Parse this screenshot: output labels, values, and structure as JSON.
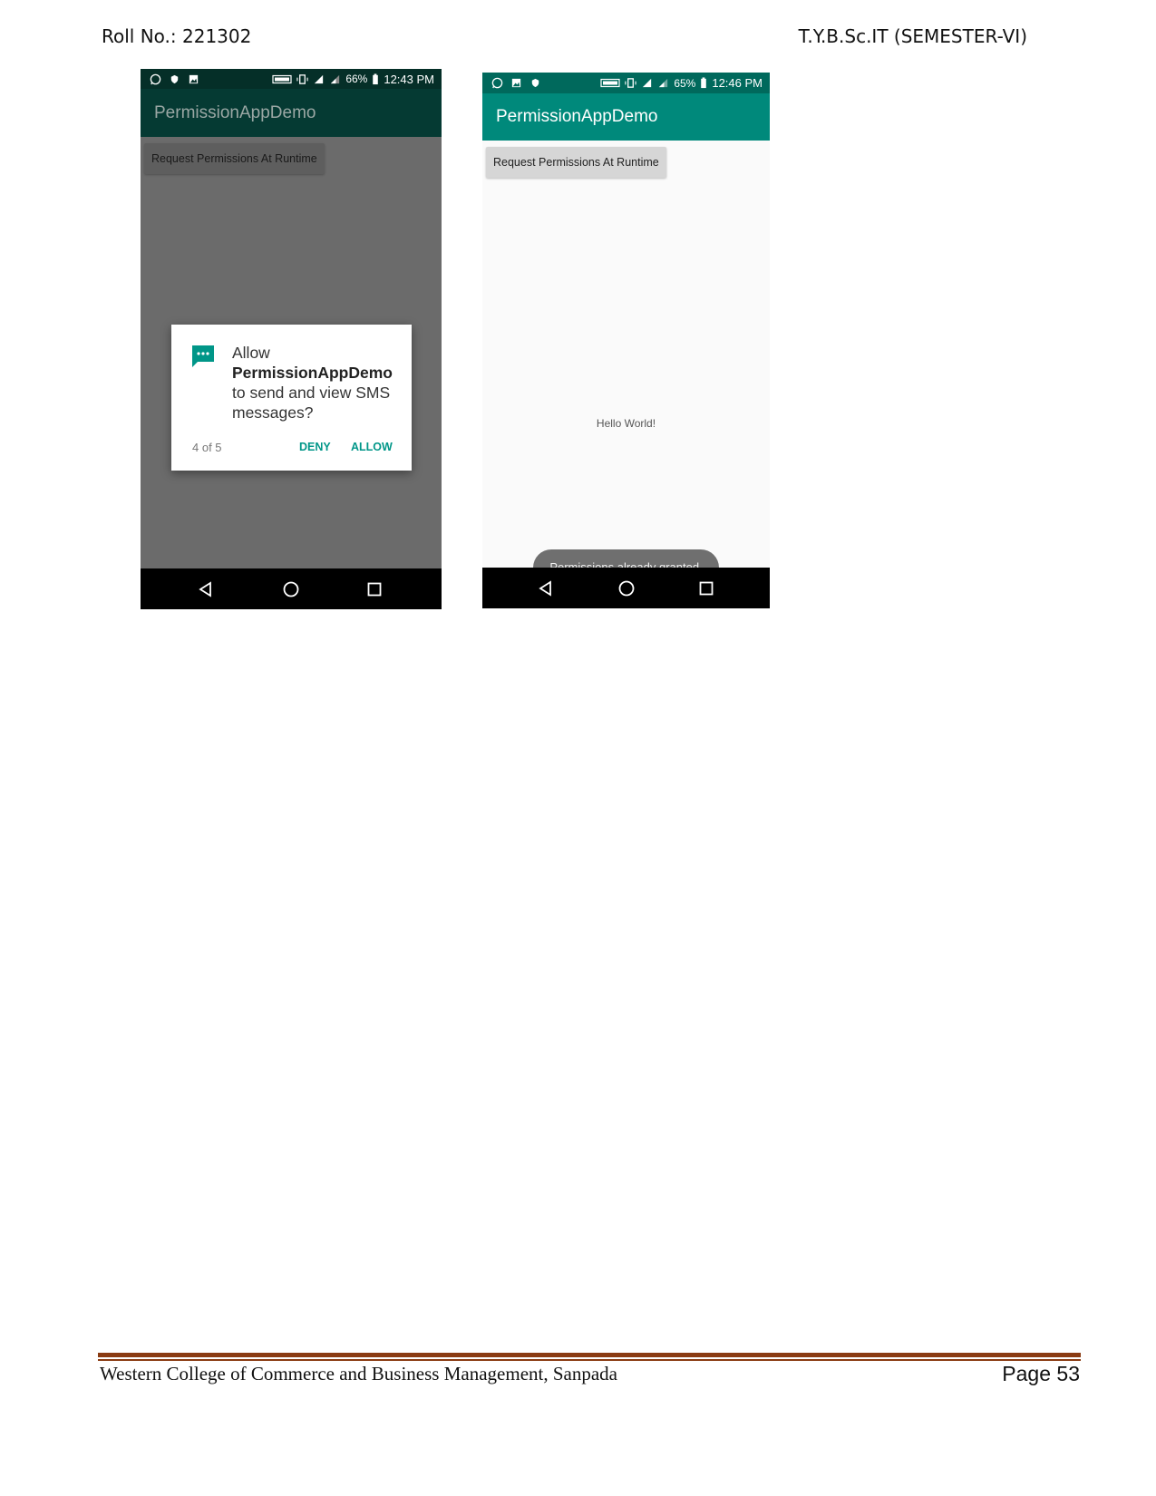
{
  "header": {
    "roll_no": "Roll No.: 221302",
    "course": "T.Y.B.Sc.IT (SEMESTER-VI)"
  },
  "phone1": {
    "status": {
      "battery": "66%",
      "time": "12:43 PM"
    },
    "app_title": "PermissionAppDemo",
    "button_label": "Request Permissions At Runtime",
    "dialog": {
      "line_allow": "Allow",
      "app_name": "PermissionAppDemo",
      "line_rest1": "to send and view SMS",
      "line_rest2": "messages?",
      "counter": "4 of 5",
      "deny_label": "DENY",
      "allow_label": "ALLOW",
      "icon": "sms-icon",
      "accent": "#009688"
    }
  },
  "phone2": {
    "status": {
      "battery": "65%",
      "time": "12:46 PM"
    },
    "app_title": "PermissionAppDemo",
    "button_label": "Request Permissions At Runtime",
    "hello_text": "Hello World!",
    "toast_text": "Permissions already granted."
  },
  "footer": {
    "college": "Western College of Commerce and Business Management, Sanpada",
    "page": "Page 53"
  },
  "colors": {
    "app_bar": "#00897b",
    "status_bar": "#00695c",
    "footer_rule": "#8a3b12"
  }
}
